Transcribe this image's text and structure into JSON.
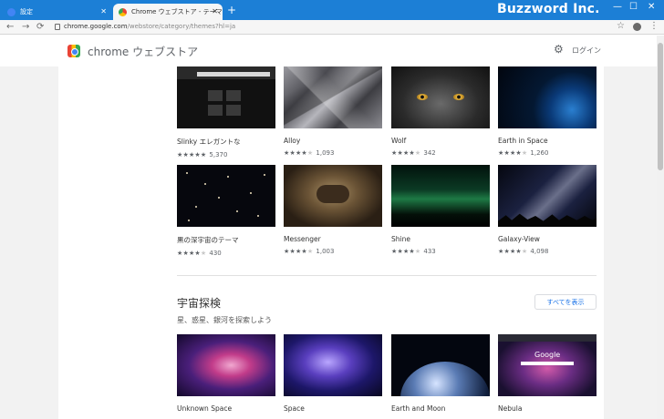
{
  "window": {
    "tabs": [
      {
        "label": "設定",
        "favicon_color": "#4285f4"
      },
      {
        "label": "Chrome ウェブストア - テーマ",
        "favicon_color": "#34a853"
      }
    ],
    "new_tab_symbol": "+",
    "brand": "Buzzword Inc.",
    "buttons": {
      "minimize": "—",
      "maximize": "☐",
      "close": "✕"
    }
  },
  "toolbar": {
    "url_host": "chrome.google.com",
    "url_path": "/webstore/category/themes?hl=ja"
  },
  "header": {
    "store_title": "chrome ウェブストア",
    "login_label": "ログイン"
  },
  "themes_top": [
    {
      "name": "Slinky エレガントな",
      "stars": 5,
      "count": "5,370"
    },
    {
      "name": "Alloy",
      "stars": 3.5,
      "count": "1,093"
    },
    {
      "name": "Wolf",
      "stars": 4,
      "count": "342"
    },
    {
      "name": "Earth in Space",
      "stars": 4,
      "count": "1,260"
    },
    {
      "name": "黒の深宇宙のテーマ",
      "stars": 4,
      "count": "430"
    },
    {
      "name": "Messenger",
      "stars": 4,
      "count": "1,003"
    },
    {
      "name": "Shine",
      "stars": 3.5,
      "count": "433"
    },
    {
      "name": "Galaxy-View",
      "stars": 4,
      "count": "4,098"
    }
  ],
  "section": {
    "title": "宇宙探検",
    "description": "星、惑星、銀河を探索しよう",
    "show_all_label": "すべてを表示",
    "items": [
      {
        "name": "Unknown Space"
      },
      {
        "name": "Space"
      },
      {
        "name": "Earth and Moon"
      },
      {
        "name": "Nebula"
      }
    ]
  },
  "nebula_thumb_text": "Google",
  "colors": {
    "accent": "#1a73e8",
    "titlebar": "#1c7fd6"
  }
}
